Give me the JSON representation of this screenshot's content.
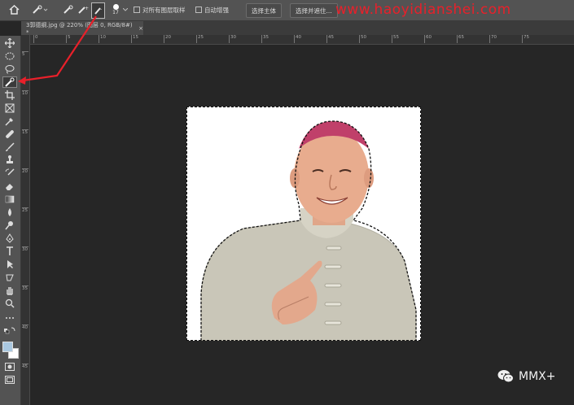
{
  "options_bar": {
    "brush_size": "17",
    "sample_all_layers_label": "对所有图层取样",
    "auto_enhance_label": "自动增强",
    "select_subject_label": "选择主体",
    "select_and_mask_label": "选择并遮住..."
  },
  "watermark": "www.haoyidianshei.com",
  "document_tab": {
    "title": "3郭德纲.jpg @ 220% (图层 0, RGB/8#) *",
    "close": "×"
  },
  "rulers": {
    "h_ticks": [
      "0",
      "5",
      "10",
      "15",
      "20",
      "25",
      "30",
      "35",
      "40",
      "45",
      "50",
      "55",
      "60",
      "65",
      "70",
      "75"
    ],
    "v_ticks": [
      "5",
      "10",
      "15",
      "20",
      "25",
      "30",
      "35",
      "40",
      "45"
    ]
  },
  "wechat_badge": {
    "name": "MMX+"
  },
  "colors": {
    "annotation_arrow": "#e8202a",
    "foreground": "#a9c7df",
    "background": "#ffffff"
  }
}
